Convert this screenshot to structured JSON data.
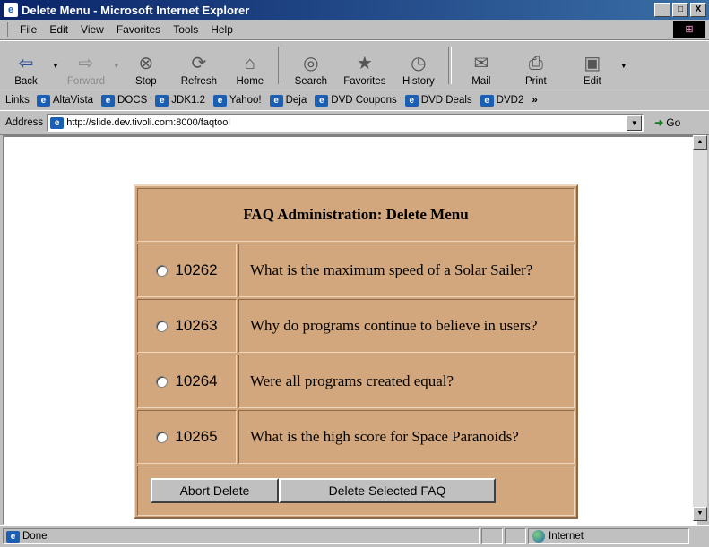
{
  "window": {
    "title": "Delete Menu - Microsoft Internet Explorer",
    "buttons": [
      "_",
      "□",
      "X"
    ]
  },
  "menu": {
    "items": [
      {
        "label": "File"
      },
      {
        "label": "Edit"
      },
      {
        "label": "View"
      },
      {
        "label": "Favorites"
      },
      {
        "label": "Tools"
      },
      {
        "label": "Help"
      }
    ]
  },
  "toolbar": {
    "back": "Back",
    "forward": "Forward",
    "stop": "Stop",
    "refresh": "Refresh",
    "home": "Home",
    "search": "Search",
    "favorites": "Favorites",
    "history": "History",
    "mail": "Mail",
    "print": "Print",
    "edit": "Edit"
  },
  "links": {
    "label": "Links",
    "items": [
      "AltaVista",
      "DOCS",
      "JDK1.2",
      "Yahoo!",
      "Deja",
      "DVD Coupons",
      "DVD Deals",
      "DVD2"
    ]
  },
  "address": {
    "label": "Address",
    "url": "http://slide.dev.tivoli.com:8000/faqtool",
    "go": "Go"
  },
  "page": {
    "heading": "FAQ Administration: Delete Menu",
    "faqs": [
      {
        "id": "10262",
        "question": "What is the maximum speed of a Solar Sailer?"
      },
      {
        "id": "10263",
        "question": "Why do programs continue to believe in users?"
      },
      {
        "id": "10264",
        "question": "Were all programs created equal?"
      },
      {
        "id": "10265",
        "question": "What is the high score for Space Paranoids?"
      }
    ],
    "abort_label": "Abort Delete",
    "delete_label": "Delete Selected FAQ"
  },
  "status": {
    "text": "Done",
    "zone": "Internet"
  }
}
